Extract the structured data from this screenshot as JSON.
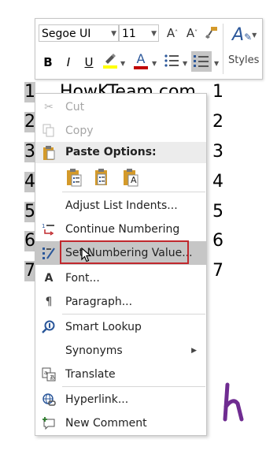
{
  "document": {
    "title_text": "HowKTeam.com",
    "left_numbers": [
      "1",
      "2",
      "3",
      "4",
      "5",
      "6",
      "7"
    ],
    "right_numbers": [
      "1",
      "2",
      "3",
      "4",
      "5",
      "6",
      "7"
    ]
  },
  "toolbar": {
    "font_name": "Segoe UI",
    "font_size": "11",
    "grow_font": "A",
    "shrink_font": "A",
    "bold": "B",
    "italic": "I",
    "underline": "U",
    "font_color": "A",
    "styles_icon": "A",
    "styles_label": "Styles"
  },
  "menu": {
    "cut": "Cut",
    "copy": "Copy",
    "paste_options": "Paste Options:",
    "adjust_list_indents": "Adjust List Indents...",
    "continue_numbering": "Continue Numbering",
    "set_numbering_value": "Set Numbering Value...",
    "font": "Font...",
    "paragraph": "Paragraph...",
    "smart_lookup": "Smart Lookup",
    "synonyms": "Synonyms",
    "translate": "Translate",
    "hyperlink": "Hyperlink...",
    "new_comment": "New Comment",
    "paste_icon_letter": "A",
    "font_icon_letter": "A"
  },
  "colors": {
    "highlight": "#c6c6c6",
    "selection_border": "#c0282d",
    "accent_blue": "#2b579a",
    "logo_purple": "#6f2c91"
  }
}
